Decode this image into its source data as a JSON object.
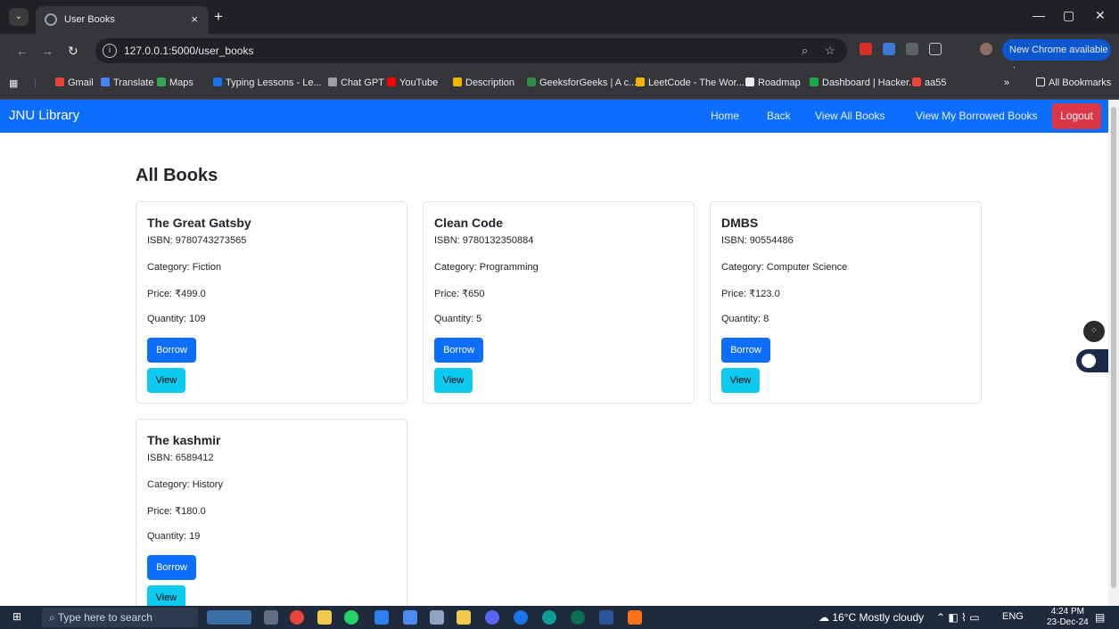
{
  "browser": {
    "tab_title": "User Books",
    "tab_close": "×",
    "new_tab": "+",
    "url": "127.0.0.1:5000/user_books",
    "new_chrome": "New Chrome available",
    "bookmarks": [
      {
        "label": "Gmail",
        "color": "#ea4335"
      },
      {
        "label": "Translate",
        "color": "#4285f4"
      },
      {
        "label": "Maps",
        "color": "#34a853"
      },
      {
        "label": "Typing Lessons - Le...",
        "color": "#1a73e8"
      },
      {
        "label": "Chat GPT",
        "color": "#9aa0a6"
      },
      {
        "label": "YouTube",
        "color": "#ff0000"
      },
      {
        "label": "Description",
        "color": "#f4b400"
      },
      {
        "label": "GeeksforGeeks | A c...",
        "color": "#2f8d46"
      },
      {
        "label": "LeetCode - The Wor...",
        "color": "#f4b400"
      },
      {
        "label": "Roadmap",
        "color": "#e8eaed"
      },
      {
        "label": "Dashboard | Hacker...",
        "color": "#1ba94c"
      },
      {
        "label": "aa55",
        "color": "#ea4335"
      }
    ],
    "all_bookmarks": "All Bookmarks"
  },
  "navbar": {
    "brand": "JNU Library",
    "links": [
      "Home",
      "Back",
      "View All Books",
      "View My Borrowed Books"
    ],
    "logout": "Logout",
    "bg_color": "#0d6efd"
  },
  "main": {
    "heading": "All Books",
    "books": [
      {
        "title": "The Great Gatsby",
        "isbn": "ISBN: 9780743273565",
        "category": "Category: Fiction",
        "price": "Price: ₹499.0",
        "quantity": "Quantity: 109",
        "borrow": "Borrow",
        "view": "View"
      },
      {
        "title": "Clean Code",
        "isbn": "ISBN: 9780132350884",
        "category": "Category: Programming",
        "price": "Price: ₹650",
        "quantity": "Quantity: 5",
        "borrow": "Borrow",
        "view": "View"
      },
      {
        "title": "DMBS",
        "isbn": "ISBN: 90554486",
        "category": "Category: Computer Science",
        "price": "Price: ₹123.0",
        "quantity": "Quantity: 8",
        "borrow": "Borrow",
        "view": "View"
      },
      {
        "title": "The kashmir",
        "isbn": "ISBN: 6589412",
        "category": "Category: History",
        "price": "Price: ₹180.0",
        "quantity": "Quantity: 19",
        "borrow": "Borrow",
        "view": "View"
      }
    ]
  },
  "taskbar": {
    "search_placeholder": "Type here to search",
    "weather": "16°C  Mostly cloudy",
    "lang": "ENG",
    "time": "4:24 PM",
    "date": "23-Dec-24"
  }
}
